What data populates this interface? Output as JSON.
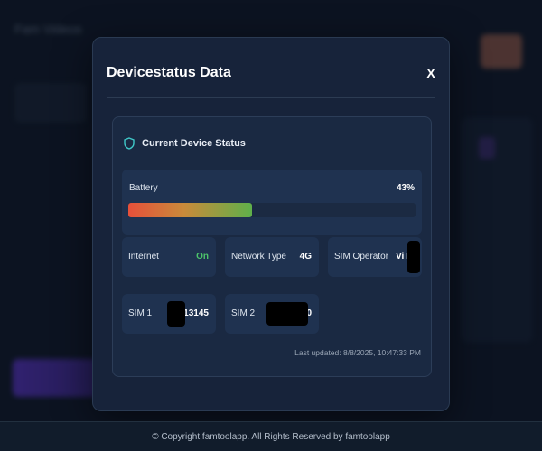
{
  "background": {
    "app_title": "Fam Videos"
  },
  "modal": {
    "title": "Devicestatus Data",
    "close_label": "X",
    "card_title": "Current Device Status",
    "battery": {
      "label": "Battery",
      "percent_text": "43%",
      "level": 0.43
    },
    "internet": {
      "label": "Internet",
      "value": "On"
    },
    "network_type": {
      "label": "Network Type",
      "value": "4G"
    },
    "sim_operator": {
      "label": "SIM Operator",
      "value": "Vi In"
    },
    "sim1": {
      "label": "SIM 1",
      "value": "0813145"
    },
    "sim2": {
      "label": "SIM 2",
      "value": "0"
    },
    "last_updated": "Last updated: 8/8/2025, 10:47:33 PM"
  },
  "footer": {
    "copyright": "© Copyright famtoolapp. All Rights Reserved by famtoolapp"
  },
  "colors": {
    "modal_bg": "#17233a",
    "card_bg": "#1a2942",
    "tile_bg": "#1f3250",
    "accent_green": "#4cc46a",
    "shield_icon": "#3fc8c8"
  },
  "icons": {
    "card_header": "shield-icon",
    "close": "close-icon"
  }
}
